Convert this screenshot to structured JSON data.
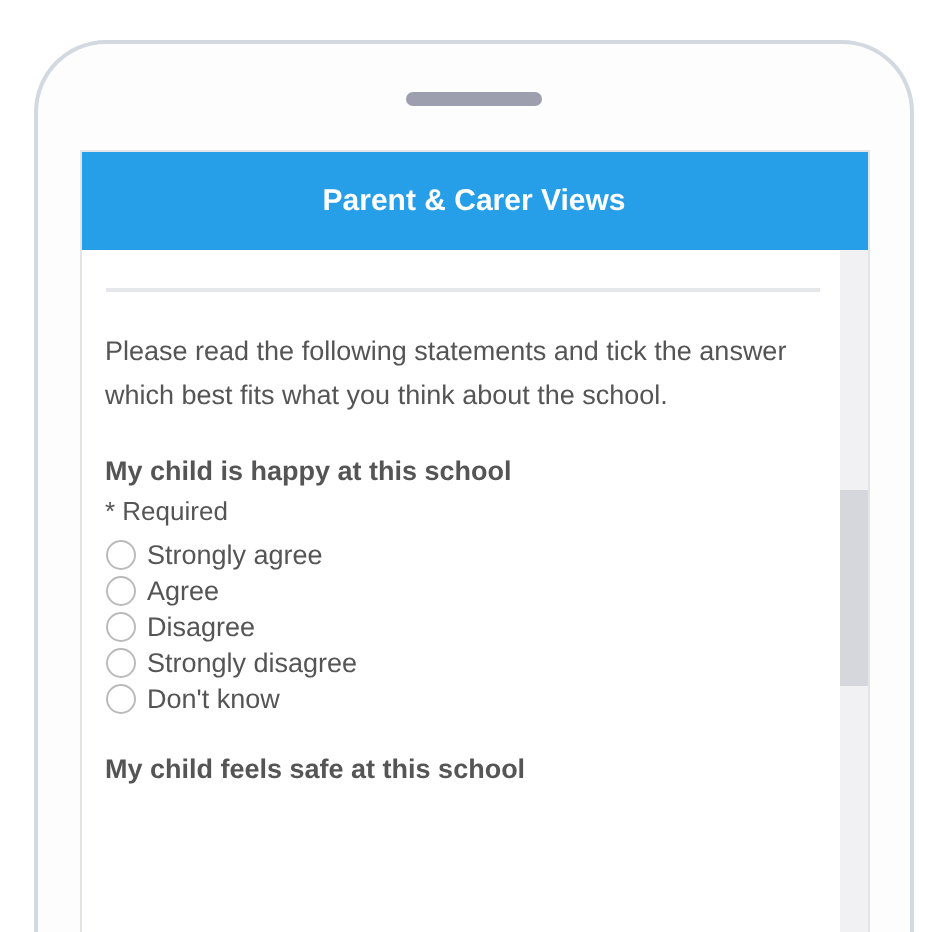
{
  "header": {
    "title": "Parent & Carer Views"
  },
  "intro": "Please read the following statements and tick the answer which best fits what you think about the school.",
  "questions": [
    {
      "title": "My child is happy at this school",
      "required": "* Required",
      "options": [
        {
          "label": "Strongly agree",
          "selected": false
        },
        {
          "label": "Agree",
          "selected": false
        },
        {
          "label": "Disagree",
          "selected": false
        },
        {
          "label": "Strongly disagree",
          "selected": false
        },
        {
          "label": "Don't know",
          "selected": false
        }
      ]
    },
    {
      "title": "My child feels safe at this school"
    }
  ]
}
